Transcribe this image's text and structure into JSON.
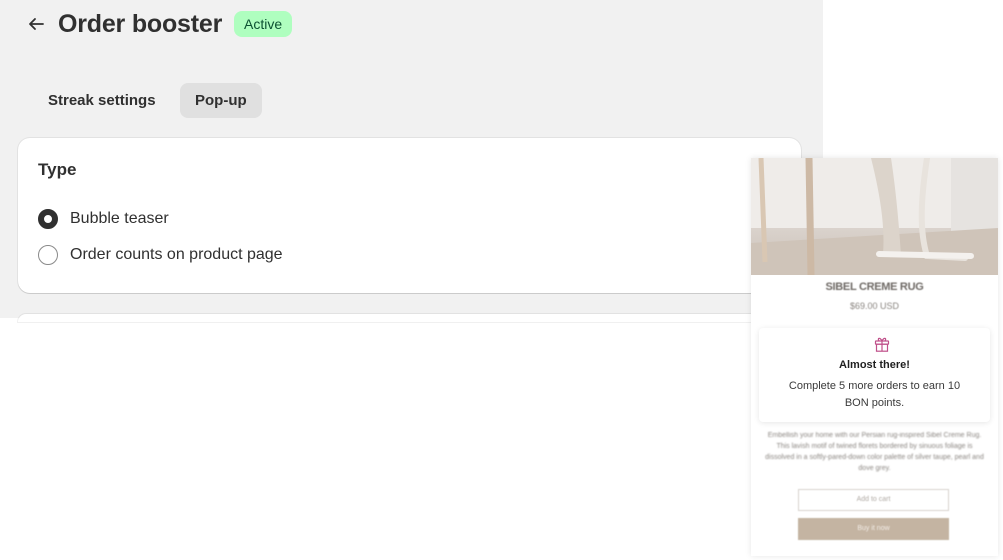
{
  "header": {
    "title": "Order booster",
    "status_badge": "Active"
  },
  "tabs": [
    {
      "label": "Streak settings",
      "selected": false
    },
    {
      "label": "Pop-up",
      "selected": true
    }
  ],
  "type_card": {
    "title": "Type",
    "options": [
      {
        "label": "Bubble teaser",
        "selected": true
      },
      {
        "label": "Order counts on product page",
        "selected": false
      }
    ]
  },
  "preview": {
    "product_name": "SIBEL CREME RUG",
    "price": "$69.00 USD",
    "teaser": {
      "title": "Almost there!",
      "message": "Complete 5 more orders to earn 10 BON points."
    },
    "description": "Embellish your home with our Persian rug-inspired Sibel Creme Rug. This lavish motif of twined florets bordered by sinuous foliage is dissolved in a softly-pared-down color palette of silver taupe, pearl and dove grey.",
    "quantity_placeholder": "Add to cart",
    "buy_button": "Buy it now"
  },
  "colors": {
    "admin_background": "#f1f1f1",
    "badge_background": "#affebf",
    "badge_text": "#0c5132",
    "selected_tab": "#e0e0e0",
    "gift_icon": "#c0508a",
    "buy_button": "#c4b4a2"
  },
  "icons": {
    "back": "arrow-left-icon",
    "teaser": "gift-icon"
  }
}
